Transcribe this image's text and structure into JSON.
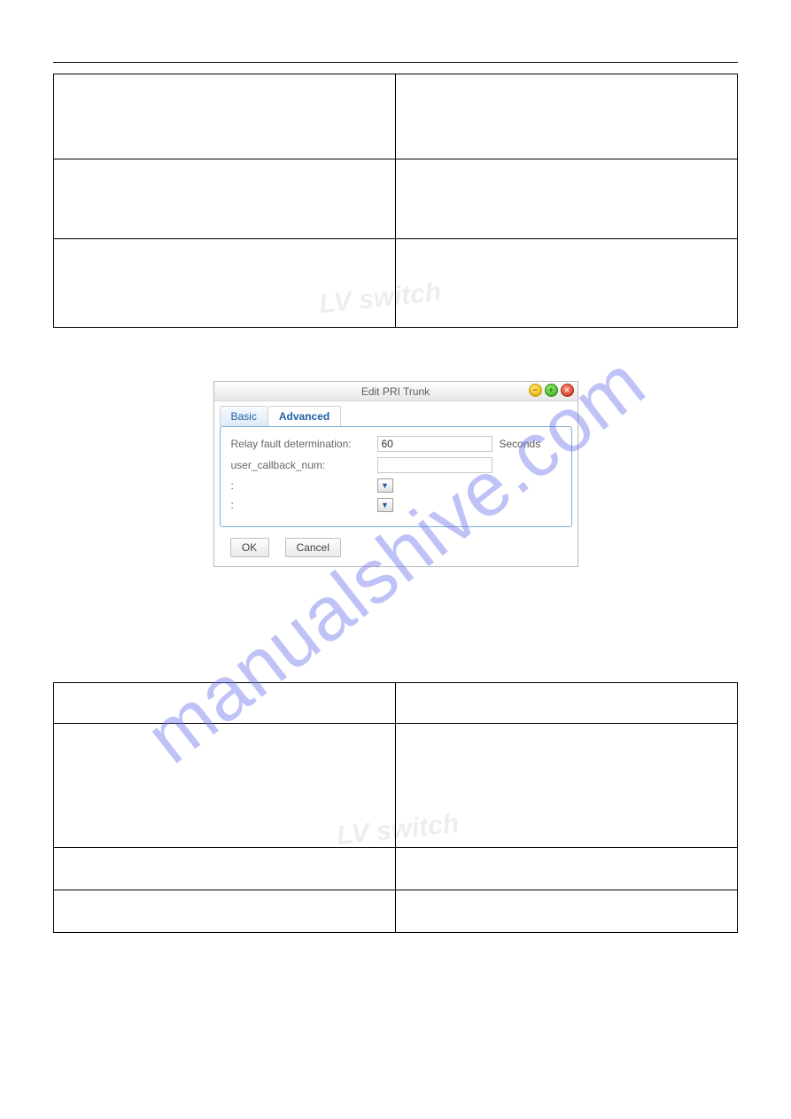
{
  "watermark_text": "manualshive.com",
  "bg_logo_text": "LV switch",
  "dialog": {
    "title": "Edit PRI Trunk",
    "tabs": {
      "basic": "Basic",
      "advanced": "Advanced"
    },
    "fields": {
      "relay_fault": {
        "label": "Relay fault determination:",
        "value": "60",
        "suffix": "Seconds"
      },
      "user_callback": {
        "label": "user_callback_num:",
        "value": ""
      },
      "row3": {
        "label": ":"
      },
      "row4": {
        "label": ":"
      }
    },
    "buttons": {
      "ok": "OK",
      "cancel": "Cancel"
    },
    "window_controls": {
      "min": "−",
      "max": "+",
      "close": "×"
    }
  }
}
